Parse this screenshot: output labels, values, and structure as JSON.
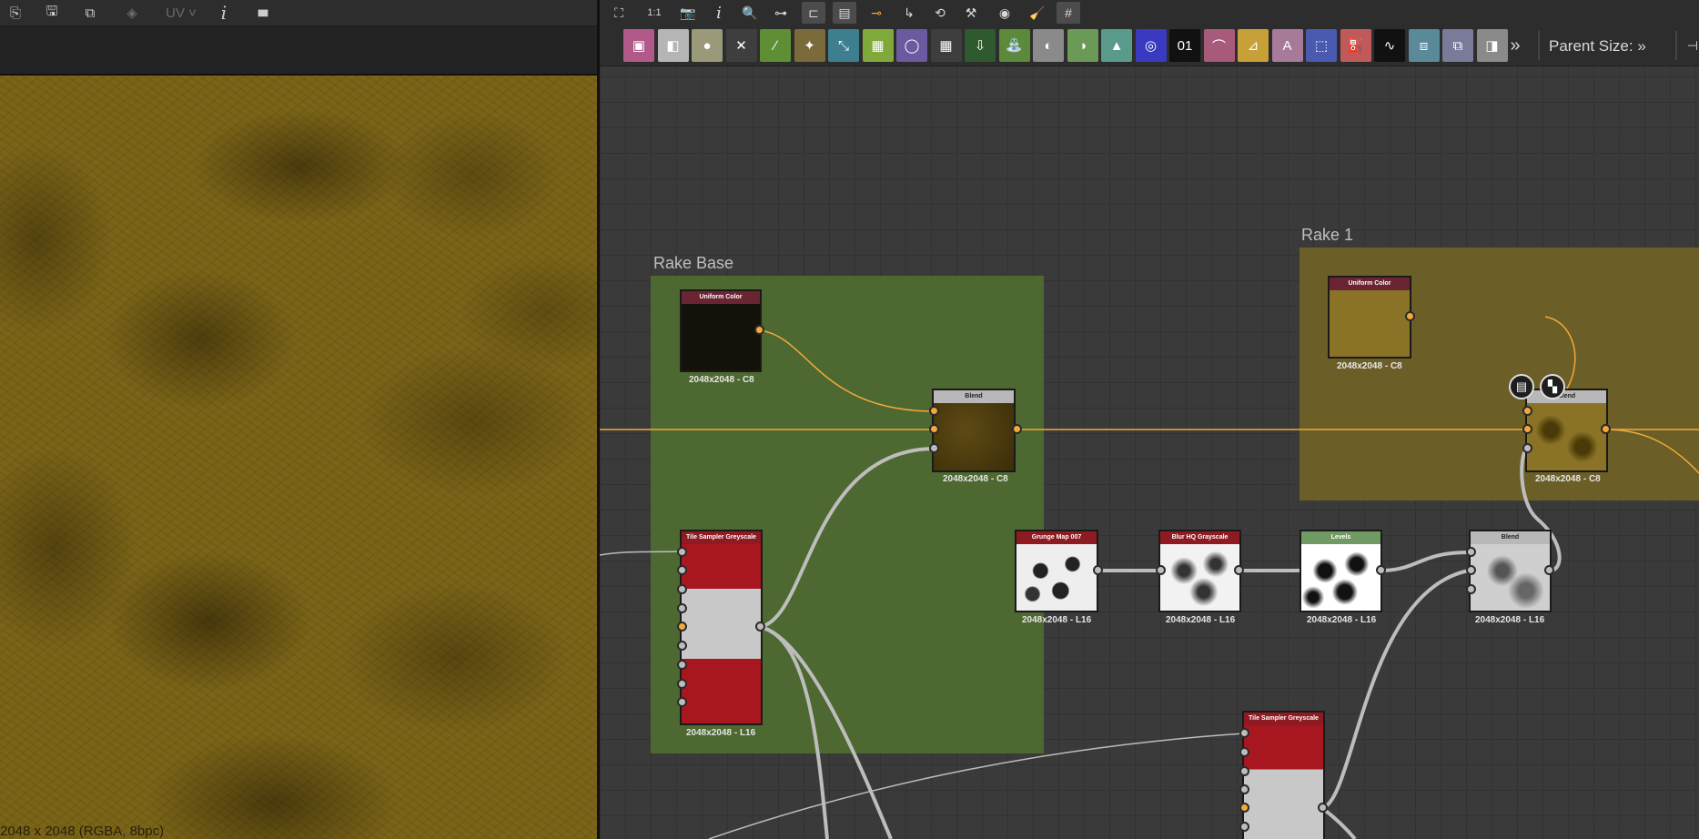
{
  "left_view": {
    "toolbar": [
      {
        "name": "export-icon",
        "glyph": "⎘"
      },
      {
        "name": "save-icon",
        "glyph": "🖫"
      },
      {
        "name": "copy-icon",
        "glyph": "⧉"
      },
      {
        "name": "channels-icon",
        "glyph": "◈"
      },
      {
        "name": "uv-label",
        "glyph": "UV ˅"
      },
      {
        "name": "info-icon",
        "glyph": "i"
      },
      {
        "name": "histogram-icon",
        "glyph": "▮▮▮"
      }
    ],
    "status_text": "2048 x 2048 (RGBA, 8bpc)"
  },
  "graph_toolbar": {
    "tools": [
      {
        "name": "frame-view-icon",
        "glyph": "⛶"
      },
      {
        "name": "zoom-1-1-icon",
        "glyph": "1:1"
      },
      {
        "name": "camera-icon",
        "glyph": "📷"
      },
      {
        "name": "info-icon",
        "glyph": "i"
      },
      {
        "name": "search-icon",
        "glyph": "🔍"
      },
      {
        "name": "link-tool-icon",
        "glyph": "⊶"
      },
      {
        "name": "graph-layout-icon",
        "glyph": "⊏"
      },
      {
        "name": "align-icon",
        "glyph": "▤"
      },
      {
        "name": "connect-icon",
        "glyph": "⊸"
      },
      {
        "name": "route-icon",
        "glyph": "↳"
      },
      {
        "name": "history-icon",
        "glyph": "⟲"
      },
      {
        "name": "tools-icon",
        "glyph": "⚒"
      },
      {
        "name": "preview-icon",
        "glyph": "◉"
      },
      {
        "name": "clean-icon",
        "glyph": "🧹"
      },
      {
        "name": "grid-snap-icon",
        "glyph": "#"
      }
    ],
    "library": [
      {
        "name": "bitmap-lib-icon",
        "color": "#b15a8a",
        "glyph": "▣"
      },
      {
        "name": "svg-lib-icon",
        "color": "#b5b5b5",
        "glyph": "◧"
      },
      {
        "name": "droplet-lib-icon",
        "color": "#9a9a7a",
        "glyph": "●"
      },
      {
        "name": "shuffle-lib-icon",
        "color": "#3e3e3e",
        "glyph": "✕"
      },
      {
        "name": "curve-lib-icon",
        "color": "#5f8f35",
        "glyph": "∕"
      },
      {
        "name": "warp-lib-icon",
        "color": "#7b6a3a",
        "glyph": "✦"
      },
      {
        "name": "transform-lib-icon",
        "color": "#3d7f8f",
        "glyph": "⤡"
      },
      {
        "name": "gradient-lib-icon",
        "color": "#7fa93a",
        "glyph": "▦"
      },
      {
        "name": "circle-lib-icon",
        "color": "#6c5aa0",
        "glyph": "◯"
      },
      {
        "name": "tile-lib-icon",
        "color": "#3e3e3e",
        "glyph": "▦"
      },
      {
        "name": "output-lib-icon",
        "color": "#2f5a2f",
        "glyph": "⇩"
      },
      {
        "name": "input-lib-icon",
        "color": "#5a8a3a",
        "glyph": "⛲"
      },
      {
        "name": "switch-lib-icon",
        "color": "#8a8a8a",
        "glyph": "◐"
      },
      {
        "name": "contrast-lib-icon",
        "color": "#6a9a55",
        "glyph": "◑"
      },
      {
        "name": "histogram-lib-icon",
        "color": "#5a9a8a",
        "glyph": "▲"
      },
      {
        "name": "hsl-lib-icon",
        "color": "#3a3ac0",
        "glyph": "◎"
      },
      {
        "name": "noise-lib-icon",
        "color": "#111111",
        "glyph": "01"
      },
      {
        "name": "pattern-lib-icon",
        "color": "#a85a7a",
        "glyph": "⌒"
      },
      {
        "name": "mirror-lib-icon",
        "color": "#c8a03a",
        "glyph": "⊿"
      },
      {
        "name": "text-lib-icon",
        "color": "#a87a9a",
        "glyph": "A"
      },
      {
        "name": "selection-lib-icon",
        "color": "#4a5ab0",
        "glyph": "⬚"
      },
      {
        "name": "fill-lib-icon",
        "color": "#c05a5a",
        "glyph": "⛽"
      },
      {
        "name": "fx-lib-icon",
        "color": "#111111",
        "glyph": "∿"
      },
      {
        "name": "warp2-lib-icon",
        "color": "#5a8a9a",
        "glyph": "⧈"
      },
      {
        "name": "image-lib-icon",
        "color": "#7a7a9a",
        "glyph": "⧉"
      },
      {
        "name": "output2-lib-icon",
        "color": "#8a8a8a",
        "glyph": "◨"
      }
    ],
    "more_glyph": "»",
    "parent_size_label": "Parent Size: »"
  },
  "frames": {
    "rake_base": "Rake Base",
    "rake_1": "Rake 1"
  },
  "nodes": {
    "uniform_base": {
      "title": "Uniform Color",
      "caption": "2048x2048 - C8"
    },
    "blend_base": {
      "title": "Blend",
      "caption": "2048x2048 - C8"
    },
    "tile_sampler_1": {
      "title": "Tile Sampler Greyscale",
      "caption": "2048x2048 - L16"
    },
    "grunge": {
      "title": "Grunge Map 007",
      "caption": "2048x2048 - L16"
    },
    "blur": {
      "title": "Blur HQ Grayscale",
      "caption": "2048x2048 - L16"
    },
    "levels": {
      "title": "Levels",
      "caption": "2048x2048 - L16"
    },
    "blend_grey": {
      "title": "Blend",
      "caption": "2048x2048 - L16"
    },
    "uniform_rake1": {
      "title": "Uniform Color",
      "caption": "2048x2048 - C8"
    },
    "blend_rake1": {
      "title": "Blend",
      "caption": "2048x2048 - C8"
    },
    "tile_sampler_2": {
      "title": "Tile Sampler Greyscale",
      "caption": ""
    }
  },
  "colors": {
    "header_red": "#8e1a22",
    "header_maroon": "#6b2432",
    "header_grey": "#b8b8b8",
    "header_green": "#6f9a62",
    "wire_orange": "#f2a93a",
    "wire_grey": "#bdbdbd",
    "frame_green": "#4d6830",
    "frame_olive": "#6b5f27"
  }
}
